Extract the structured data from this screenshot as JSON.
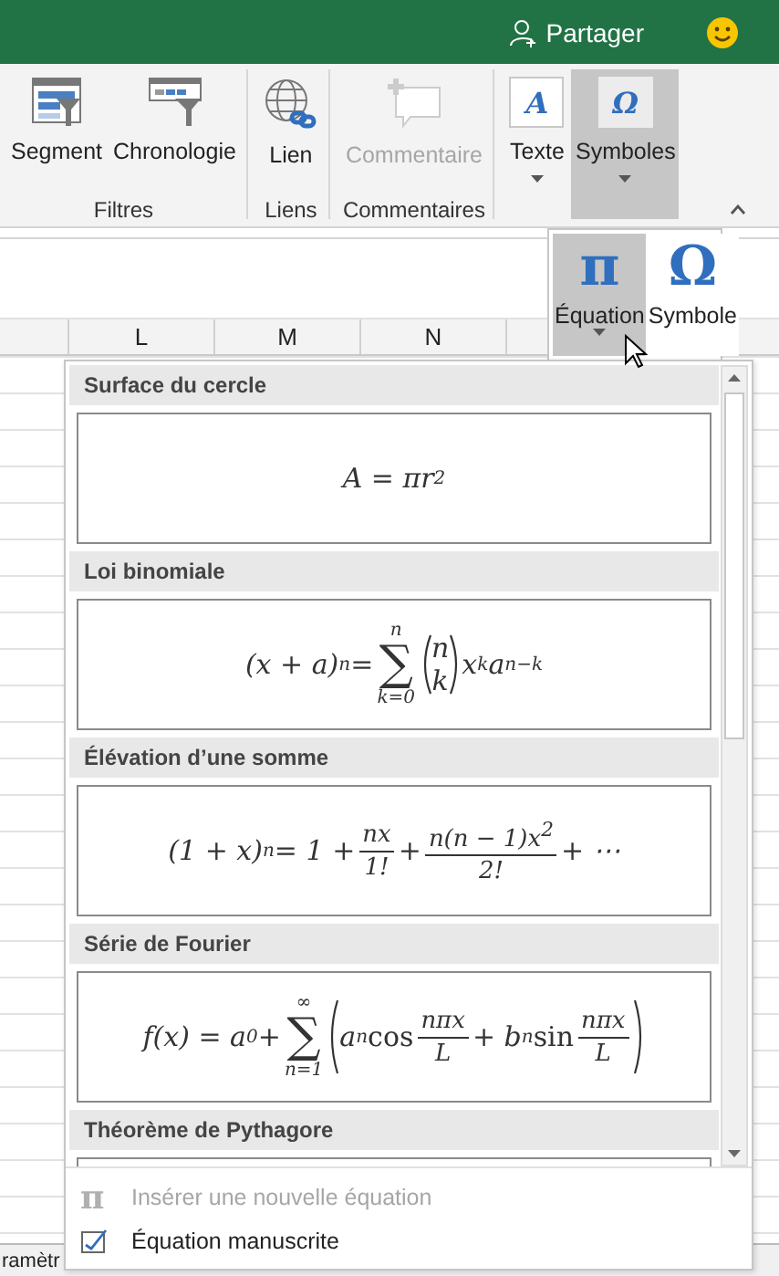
{
  "title_bar": {
    "share": "Partager"
  },
  "ribbon": {
    "groups": [
      {
        "label": "Filtres",
        "buttons": [
          {
            "label": "Segment",
            "kind": "slicer",
            "disabled": false,
            "selected": false
          },
          {
            "label": "Chronologie",
            "kind": "timeline",
            "disabled": false,
            "selected": false
          }
        ]
      },
      {
        "label": "Liens",
        "buttons": [
          {
            "label": "Lien",
            "kind": "link",
            "disabled": false,
            "selected": false
          }
        ]
      },
      {
        "label": "Commentaires",
        "buttons": [
          {
            "label": "Commentaire",
            "kind": "comment",
            "disabled": true,
            "selected": false
          }
        ]
      },
      {
        "buttons": [
          {
            "label": "Texte",
            "kind": "glyph",
            "glyph": "A",
            "dropdown": true,
            "disabled": false,
            "selected": false
          },
          {
            "label": "Symboles",
            "kind": "glyph",
            "glyph": "Ω",
            "dropdown": true,
            "disabled": false,
            "selected": true
          }
        ]
      }
    ]
  },
  "sheet": {
    "columns": [
      {
        "label": "L"
      },
      {
        "label": "M"
      },
      {
        "label": "N"
      }
    ],
    "sheet_tab": "ramètr"
  },
  "symbols_menu": [
    {
      "label": "Équation",
      "glyph": "π",
      "dropdown": true,
      "selected": true
    },
    {
      "label": "Symbole",
      "glyph": "Ω",
      "dropdown": false,
      "selected": false
    }
  ],
  "equation_gallery": {
    "items": [
      {
        "title": "Surface du cercle",
        "formula": [
          {
            "kind": "t",
            "text": "A = πr"
          },
          {
            "kind": "sup",
            "text": "2"
          }
        ]
      },
      {
        "title": "Loi binomiale",
        "formula": [
          {
            "kind": "t",
            "text": "(x + a)"
          },
          {
            "kind": "sup",
            "text": "n"
          },
          {
            "kind": "t",
            "text": " = "
          },
          {
            "kind": "sum",
            "symbol": "∑",
            "over": "n",
            "under": "k=0"
          },
          {
            "kind": "binom",
            "top": "n",
            "bottom": "k"
          },
          {
            "kind": "t",
            "text": "x"
          },
          {
            "kind": "sup",
            "text": "k"
          },
          {
            "kind": "t",
            "text": "a"
          },
          {
            "kind": "sup",
            "text": "n−k"
          }
        ]
      },
      {
        "title": "Élévation d’une somme",
        "formula": [
          {
            "kind": "t",
            "text": "(1 + x)"
          },
          {
            "kind": "sup",
            "text": "n"
          },
          {
            "kind": "t",
            "text": " = 1 + "
          },
          {
            "kind": "frac",
            "num": "nx",
            "den": "1!"
          },
          {
            "kind": "t",
            "text": " + "
          },
          {
            "kind": "frac",
            "num": "n(n − 1)x$^{2}$",
            "den": "2!"
          },
          {
            "kind": "t",
            "text": " + ⋯"
          }
        ]
      },
      {
        "title": "Série de Fourier",
        "formula": [
          {
            "kind": "t",
            "text": "f(x) = a"
          },
          {
            "kind": "sub",
            "text": "0"
          },
          {
            "kind": "t",
            "text": " + "
          },
          {
            "kind": "sum",
            "symbol": "∑",
            "over": "∞",
            "under": "n=1"
          },
          {
            "kind": "paren",
            "items": [
              {
                "kind": "t",
                "text": "a"
              },
              {
                "kind": "sub",
                "text": "n"
              },
              {
                "kind": "fn",
                "text": " cos"
              },
              {
                "kind": "frac",
                "num": "nπx",
                "den": "L"
              },
              {
                "kind": "t",
                "text": " + b"
              },
              {
                "kind": "sub",
                "text": "n"
              },
              {
                "kind": "fn",
                "text": " sin"
              },
              {
                "kind": "frac",
                "num": "nπx",
                "den": "L"
              }
            ]
          }
        ]
      },
      {
        "title": "Théorème de Pythagore"
      }
    ],
    "footer": [
      {
        "label": "Insérer une nouvelle équation",
        "kind": "pi",
        "glyph": "π",
        "disabled": true
      },
      {
        "label": "Équation manuscrite",
        "kind": "ink",
        "disabled": false
      }
    ]
  }
}
